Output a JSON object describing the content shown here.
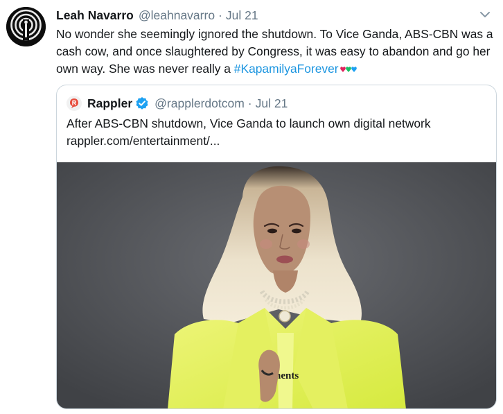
{
  "tweet": {
    "author_name": "Leah Navarro",
    "author_handle": "@leahnavarro",
    "separator": "·",
    "date": "Jul 21",
    "text_main": "No wonder she seemingly ignored the shutdown. To Vice Ganda, ABS-CBN was a cash cow, and once slaughtered by Congress, it was easy to abandon and go her own way. She was never really a ",
    "hashtag": "#KapamilyaForever",
    "heart_colors": [
      "#e0245e",
      "#17bf63",
      "#1da1f2"
    ]
  },
  "quoted_tweet": {
    "author_name": "Rappler",
    "author_handle": "@rapplerdotcom",
    "separator": "·",
    "date": "Jul 21",
    "text": "After ABS-CBN shutdown, Vice Ganda to launch own digital network",
    "link": "rappler.com/entertainment/...",
    "media": {
      "shirt_text": "ments"
    }
  },
  "colors": {
    "link_blue": "#1b95e0",
    "muted_gray": "#657786",
    "verified_blue": "#1da1f2",
    "rappler_orange": "#e74c3c"
  },
  "icons": {
    "avatar": "podcast-microphone-icon",
    "menu": "chevron-down-icon",
    "verified": "verified-badge-icon",
    "quote_avatar": "rappler-logo-icon"
  }
}
